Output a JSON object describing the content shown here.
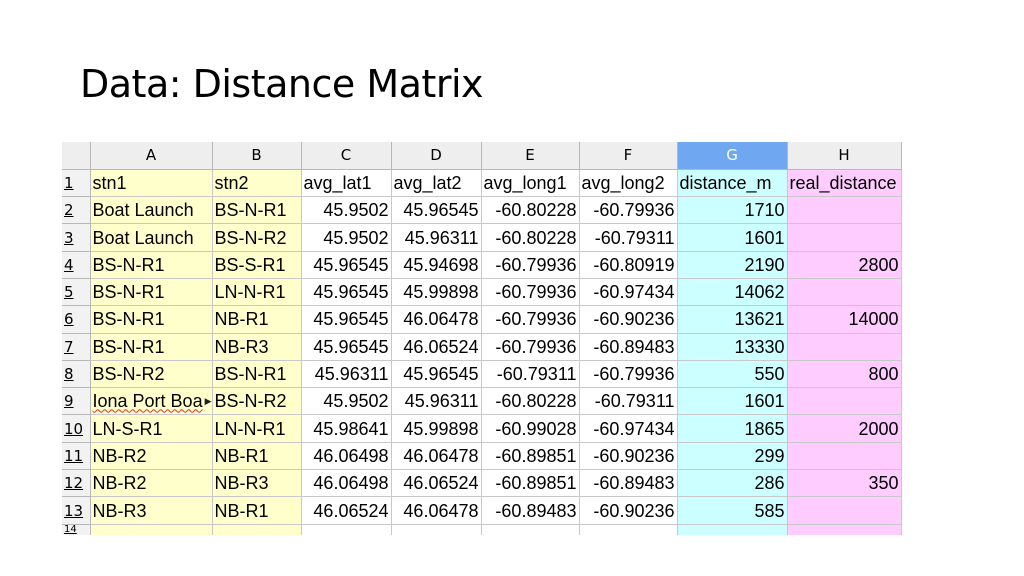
{
  "slide": {
    "title": "Data: Distance Matrix"
  },
  "spreadsheet": {
    "column_letters": [
      "A",
      "B",
      "C",
      "D",
      "E",
      "F",
      "G",
      "H"
    ],
    "selected_column": "G",
    "row_numbers": [
      "1",
      "2",
      "3",
      "4",
      "5",
      "6",
      "7",
      "8",
      "9",
      "10",
      "11",
      "12",
      "13",
      "14"
    ],
    "header_row": [
      "stn1",
      "stn2",
      "avg_lat1",
      "avg_lat2",
      "avg_long1",
      "avg_long2",
      "distance_m",
      "real_distance"
    ],
    "rows": [
      [
        "Boat Launch",
        "BS-N-R1",
        "45.9502",
        "45.96545",
        "-60.80228",
        "-60.79936",
        "1710",
        ""
      ],
      [
        "Boat Launch",
        "BS-N-R2",
        "45.9502",
        "45.96311",
        "-60.80228",
        "-60.79311",
        "1601",
        ""
      ],
      [
        "BS-N-R1",
        "BS-S-R1",
        "45.96545",
        "45.94698",
        "-60.79936",
        "-60.80919",
        "2190",
        "2800"
      ],
      [
        "BS-N-R1",
        "LN-N-R1",
        "45.96545",
        "45.99898",
        "-60.79936",
        "-60.97434",
        "14062",
        ""
      ],
      [
        "BS-N-R1",
        "NB-R1",
        "45.96545",
        "46.06478",
        "-60.79936",
        "-60.90236",
        "13621",
        "14000"
      ],
      [
        "BS-N-R1",
        "NB-R3",
        "45.96545",
        "46.06524",
        "-60.79936",
        "-60.89483",
        "13330",
        ""
      ],
      [
        "BS-N-R2",
        "BS-N-R1",
        "45.96311",
        "45.96545",
        "-60.79311",
        "-60.79936",
        "550",
        "800"
      ],
      [
        "Iona Port Boa",
        "BS-N-R2",
        "45.9502",
        "45.96311",
        "-60.80228",
        "-60.79311",
        "1601",
        ""
      ],
      [
        "LN-S-R1",
        "LN-N-R1",
        "45.98641",
        "45.99898",
        "-60.99028",
        "-60.97434",
        "1865",
        "2000"
      ],
      [
        "NB-R2",
        "NB-R1",
        "46.06498",
        "46.06478",
        "-60.89851",
        "-60.90236",
        "299",
        ""
      ],
      [
        "NB-R2",
        "NB-R3",
        "46.06498",
        "46.06524",
        "-60.89851",
        "-60.89483",
        "286",
        "350"
      ],
      [
        "NB-R3",
        "NB-R1",
        "46.06524",
        "46.06478",
        "-60.89483",
        "-60.90236",
        "585",
        ""
      ]
    ],
    "colors": {
      "text_columns": "#ffffcc",
      "distance_column": "#ccffff",
      "real_distance_column": "#ffccff",
      "selected_header": "#6fa8f0"
    }
  }
}
